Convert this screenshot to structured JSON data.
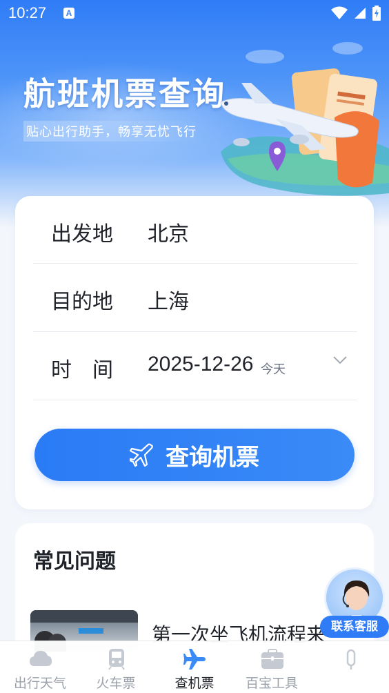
{
  "status_bar": {
    "time": "10:27",
    "app_icon_letter": "A"
  },
  "banner": {
    "title": "航班机票查询",
    "subtitle": "贴心出行助手，畅享无忧飞行"
  },
  "search_form": {
    "from_label": "出发地",
    "from_value": "北京",
    "to_label": "目的地",
    "to_value": "上海",
    "date_label": "时间",
    "date_value": "2025-12-26",
    "date_hint": "今天",
    "submit_label": "查询机票"
  },
  "faq": {
    "title": "常见问题",
    "items": [
      {
        "title": "第一次坐飞机流程来"
      }
    ]
  },
  "customer_service": {
    "label": "联系客服"
  },
  "tabs": [
    {
      "label": "出行天气",
      "icon": "cloud-icon",
      "active": false
    },
    {
      "label": "火车票",
      "icon": "train-icon",
      "active": false
    },
    {
      "label": "查机票",
      "icon": "airplane-icon",
      "active": true
    },
    {
      "label": "百宝工具",
      "icon": "toolbox-icon",
      "active": false
    },
    {
      "label": "",
      "icon": "more-icon",
      "active": false
    }
  ],
  "colors": {
    "primary": "#2f7cf6",
    "text": "#1f2329",
    "muted": "#9aa1ab",
    "background": "#f3f6fb"
  }
}
